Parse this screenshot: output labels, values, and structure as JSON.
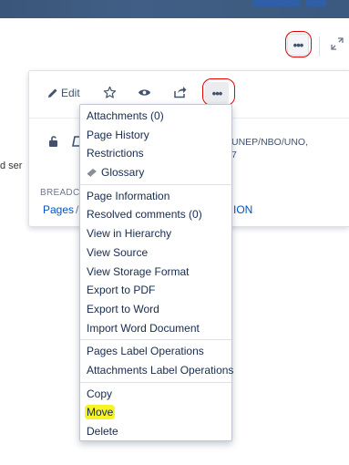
{
  "header": {
    "more_icon": "more-dots-icon",
    "expand_icon": "expand-icon"
  },
  "background": {
    "partial_text": "d ser"
  },
  "panel": {
    "toolbar": {
      "edit_label": "Edit",
      "edit_icon": "pencil-icon",
      "star_icon": "star-icon",
      "watch_icon": "eye-icon",
      "share_icon": "share-icon",
      "more_icon": "more-dots-icon"
    },
    "permission_text_1": "UNEP/NBO/UNO,",
    "permission_text_2": "7",
    "breadcrumb_label": "BREADC",
    "breadcrumb_pages": "Pages",
    "breadcrumb_sep": "/",
    "breadcrumb_end": "ION"
  },
  "menu": {
    "groups": [
      [
        "Attachments (0)",
        "Page History",
        "Restrictions",
        "Glossary"
      ],
      [
        "Page Information",
        "Resolved comments (0)",
        "View in Hierarchy",
        "View Source",
        "View Storage Format",
        "Export to PDF",
        "Export to Word",
        "Import Word Document"
      ],
      [
        "Pages Label Operations",
        "Attachments Label Operations"
      ],
      [
        "Copy",
        "Move",
        "Delete"
      ]
    ]
  },
  "colors": {
    "highlight": "#f7f325",
    "annotation": "#e60000",
    "link": "#0052cc",
    "banner": "#3e5b80"
  }
}
